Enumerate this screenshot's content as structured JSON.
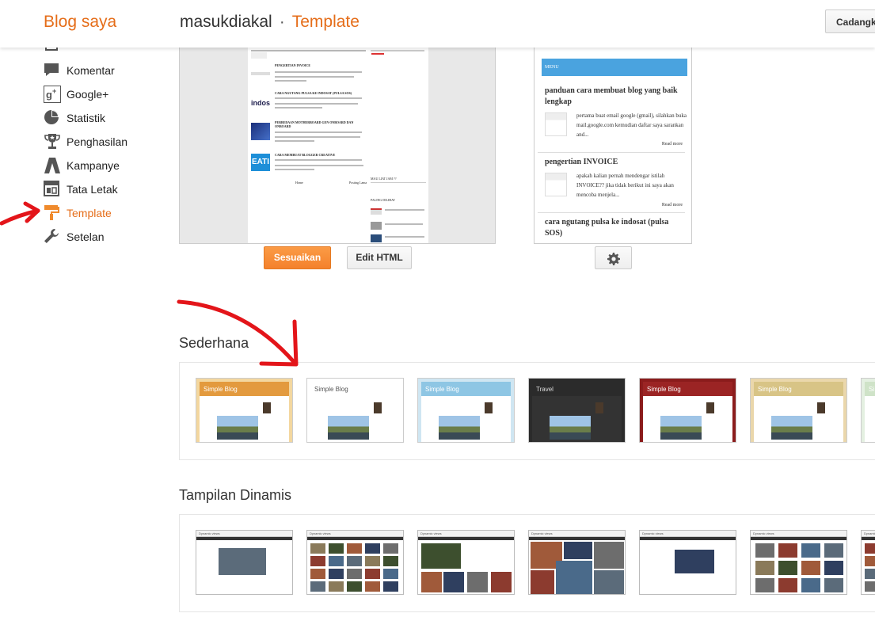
{
  "header": {
    "brand": "Blog saya",
    "blog_name": "masukdiakal",
    "separator": "·",
    "current_page": "Template",
    "backup_button": "Cadangkan"
  },
  "nav": {
    "items": [
      {
        "label": "Komentar",
        "icon": "comment-icon"
      },
      {
        "label": "Google+",
        "icon": "google-plus-icon"
      },
      {
        "label": "Statistik",
        "icon": "pie-chart-icon"
      },
      {
        "label": "Penghasilan",
        "icon": "trophy-icon"
      },
      {
        "label": "Kampanye",
        "icon": "road-icon"
      },
      {
        "label": "Tata Letak",
        "icon": "layout-icon"
      },
      {
        "label": "Template",
        "icon": "paint-roller-icon",
        "active": true
      },
      {
        "label": "Setelan",
        "icon": "wrench-icon"
      }
    ]
  },
  "desktop_preview": {
    "posts": [
      {
        "title": "PENGERTIAN INVOICE"
      },
      {
        "title": "CARA NGUTANG PULSA KE INDOSAT (PULSA SOS)",
        "thumb_label": "indos"
      },
      {
        "title": "PERBEDAAN MOTHERBOARD GEN ONBOARD DAN ONBOARD"
      },
      {
        "title": "CARA MEMBUAT BLOGGER CREATIVE",
        "thumb_label": "EATI"
      }
    ],
    "nav_newer": "Home",
    "nav_older": "Posting Lama",
    "widget_clock": "MAU LIAT JAM ??",
    "widget_popular": "PALING DILIHAT"
  },
  "mobile_preview": {
    "menu_label": "MENU",
    "posts": [
      {
        "title": "panduan cara membuat blog yang baik lengkap",
        "excerpt": "pertama buat email google (gmail), silahkan buka mail.google.com kemudian daftar saya sarankan and...",
        "more": "Read more"
      },
      {
        "title": "pengertian INVOICE",
        "excerpt": "apakah kalian pernah mendengar istilah INVOICE?? jika tidak berikut ini saya akan mencoba menjela...",
        "more": "Read more"
      },
      {
        "title": "cara ngutang pulsa ke indosat (pulsa SOS)"
      }
    ]
  },
  "actions": {
    "customize": "Sesuaikan",
    "edit_html": "Edit HTML"
  },
  "simple": {
    "title": "Sederhana",
    "templates": [
      {
        "header": "Simple Blog",
        "variant": "orange",
        "bg": "#f3d79f",
        "hdr_bg": "#e39a3e",
        "hdr_fg": "#ffffff"
      },
      {
        "header": "Simple Blog",
        "variant": "white",
        "bg": "#ffffff",
        "hdr_bg": "#ffffff",
        "hdr_fg": "#555555"
      },
      {
        "header": "Simple Blog",
        "variant": "blue",
        "bg": "#cfe6f2",
        "hdr_bg": "#8ec6e4",
        "hdr_fg": "#ffffff"
      },
      {
        "header": "Travel",
        "variant": "dark",
        "bg": "#2b2b2b",
        "hdr_bg": "#2b2b2b",
        "hdr_fg": "#dddddd"
      },
      {
        "header": "Simple Blog",
        "variant": "red",
        "bg": "#8b1c1c",
        "hdr_bg": "#9b2424",
        "hdr_fg": "#ffffff"
      },
      {
        "header": "Simple Blog",
        "variant": "beige",
        "bg": "#ead7ab",
        "hdr_bg": "#d8c486",
        "hdr_fg": "#ffffff"
      },
      {
        "header": "Si",
        "variant": "mint",
        "bg": "#e4f0e1",
        "hdr_bg": "#cfe3c8",
        "hdr_fg": "#ffffff"
      }
    ]
  },
  "dynamic": {
    "title": "Tampilan Dinamis",
    "templates": [
      {
        "bar": "Dynamic views",
        "variant": "classic"
      },
      {
        "bar": "Dynamic views",
        "variant": "flipcard"
      },
      {
        "bar": "Dynamic views",
        "variant": "magazine"
      },
      {
        "bar": "Dynamic views",
        "variant": "mosaic"
      },
      {
        "bar": "Dynamic views",
        "variant": "sidebar"
      },
      {
        "bar": "Dynamic views",
        "variant": "snapshot"
      },
      {
        "bar": "Dynamic views",
        "variant": "timeslide"
      }
    ]
  },
  "colors": {
    "accent": "#e56d19",
    "orange_button": "#f4812c",
    "annotation_red": "#e3151a"
  }
}
